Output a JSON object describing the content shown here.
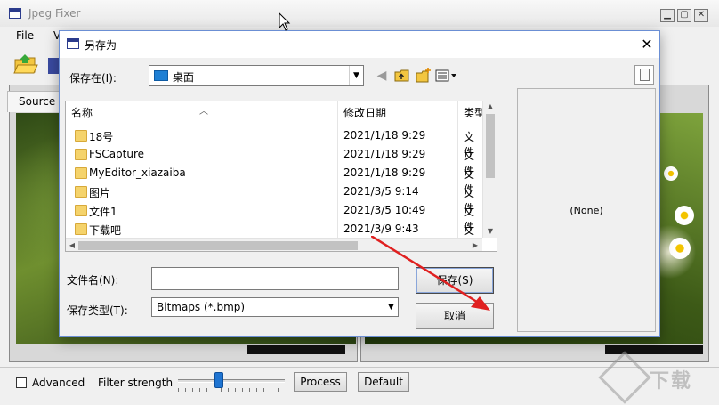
{
  "app": {
    "title": "Jpeg Fixer",
    "menu": [
      "File",
      "V"
    ],
    "source_tab": "Source",
    "advanced_label": "Advanced",
    "filter_strength_label": "Filter strength",
    "filter_strength_level": 0.38,
    "process_label": "Process",
    "default_label": "Default",
    "watermark": "下载"
  },
  "dialog": {
    "title": "另存为",
    "close_glyph": "✕",
    "save_in_label": "保存在(I):",
    "save_in_value": "桌面",
    "columns": {
      "name": "名称",
      "date": "修改日期",
      "type": "类型"
    },
    "files": [
      {
        "name": "18号",
        "date": "2021/1/18 9:29",
        "type": "文件"
      },
      {
        "name": "FSCapture",
        "date": "2021/1/18 9:29",
        "type": "文件"
      },
      {
        "name": "MyEditor_xiazaiba",
        "date": "2021/1/18 9:29",
        "type": "文件"
      },
      {
        "name": "图片",
        "date": "2021/3/5 9:14",
        "type": "文件"
      },
      {
        "name": "文件1",
        "date": "2021/3/5 10:49",
        "type": "文件"
      },
      {
        "name": "下载吧",
        "date": "2021/3/9 9:43",
        "type": "文件"
      }
    ],
    "preview_text": "(None)",
    "filename_label": "文件名(N):",
    "filename_value": "",
    "filetype_label": "保存类型(T):",
    "filetype_value": "Bitmaps (*.bmp)",
    "save_label": "保存(S)",
    "cancel_label": "取消"
  },
  "colors": {
    "accent": "#1f74d1",
    "arrow": "#e02020",
    "folder": "#f5d36b"
  }
}
